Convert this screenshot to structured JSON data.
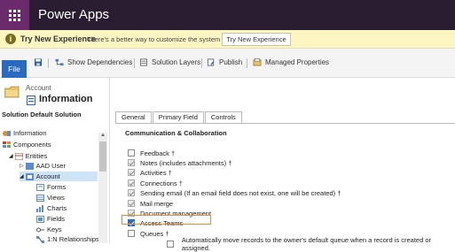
{
  "app": {
    "title": "Power Apps"
  },
  "notice": {
    "title": "Try New Experience",
    "text": "There's a better way to customize the system",
    "button": "Try New Experience"
  },
  "toolbar": {
    "file": "File",
    "show_dependencies": "Show Dependencies",
    "solution_layers": "Solution Layers",
    "publish": "Publish",
    "managed_properties": "Managed Properties"
  },
  "entity": {
    "caption": "Account",
    "name": "Information"
  },
  "solution": {
    "title": "Solution Default Solution",
    "tree": [
      {
        "label": "Information",
        "icon": "info-icon"
      },
      {
        "label": "Components",
        "icon": "components-icon"
      },
      {
        "label": "Entities",
        "icon": "entities-icon"
      },
      {
        "label": "AAD User",
        "icon": "entity-icon"
      },
      {
        "label": "Account",
        "icon": "entity-icon"
      },
      {
        "label": "Forms",
        "icon": "forms-icon"
      },
      {
        "label": "Views",
        "icon": "views-icon"
      },
      {
        "label": "Charts",
        "icon": "charts-icon"
      },
      {
        "label": "Fields",
        "icon": "fields-icon"
      },
      {
        "label": "Keys",
        "icon": "keys-icon"
      },
      {
        "label": "1:N Relationships",
        "icon": "relationships-icon"
      }
    ]
  },
  "tabs": [
    "General",
    "Primary Field",
    "Controls"
  ],
  "section": {
    "title": "Communication & Collaboration",
    "options": [
      {
        "label": "Feedback †",
        "checked": false
      },
      {
        "label": "Notes (includes attachments) †",
        "checked": true
      },
      {
        "label": "Activities †",
        "checked": true
      },
      {
        "label": "Connections †",
        "checked": true
      },
      {
        "label": "Sending email (If an email field does not exist, one will be created) †",
        "checked": true
      },
      {
        "label": "Mail merge",
        "checked": true
      },
      {
        "label": "Document management",
        "checked": true
      },
      {
        "label": "Access Teams",
        "checked": true
      },
      {
        "label": "Queues †",
        "checked": false
      }
    ],
    "sub_option": "Automatically move records to the owner's default queue when a record is created or assigned."
  },
  "colors": {
    "topbar": "#2a1c31",
    "accent": "#6a2a6b",
    "highlight": "#e78a3b",
    "notice": "#fdf6c3"
  }
}
